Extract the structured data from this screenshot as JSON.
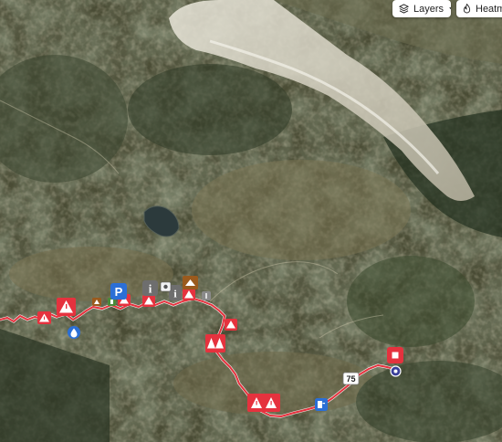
{
  "toolbar": {
    "layers_label": "Layers",
    "heatmap_label": "Heatmap"
  },
  "road_shield": "75",
  "icons": {
    "layers": "layers-icon",
    "chevron": "chevron-down-icon",
    "heatmap": "flame-icon",
    "warning": "warning-icon",
    "parking": "parking-icon",
    "info": "info-icon",
    "water": "water-drop-icon",
    "fuel": "fuel-icon",
    "finish": "finish-icon",
    "start": "start-icon"
  },
  "colors": {
    "route": "#e5323e",
    "marker_red": "#e5323e",
    "parking_blue": "#2b6fd6",
    "info_gray": "#6e6e6e",
    "brown": "#9a5a1e",
    "snow_ridge": "#d9d5c7",
    "terrain_dark": "#2e3a24",
    "terrain_light": "#6b6a48"
  },
  "labels": {
    "parking": "P",
    "info": "i"
  }
}
